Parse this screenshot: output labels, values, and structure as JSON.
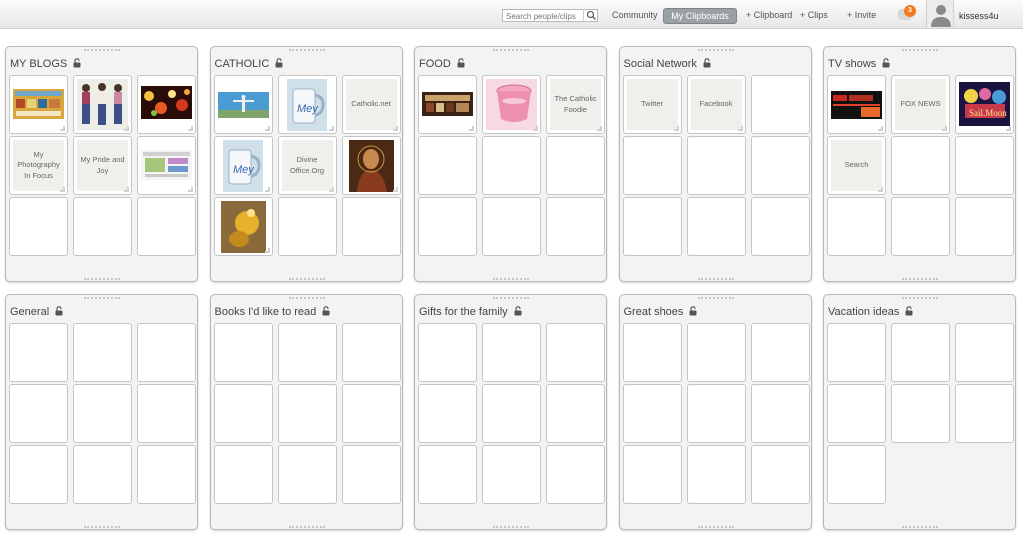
{
  "topbar": {
    "search_placeholder": "Search people/clips",
    "nav": {
      "community": "Community",
      "my_clipboards": "My Clipboards",
      "add_clipboard": "+ Clipboard",
      "add_clips": "+ Clips",
      "invite": "+ Invite"
    },
    "notification_count": "3",
    "username": "kissess4u"
  },
  "boards": [
    {
      "title": "MY BLOGS",
      "cells": [
        {
          "type": "image",
          "icon": "blog-banner"
        },
        {
          "type": "image",
          "icon": "girls-photo"
        },
        {
          "type": "image",
          "icon": "bokeh-lights"
        },
        {
          "type": "text",
          "text": "My Photography In Focus"
        },
        {
          "type": "text",
          "text": "My Pride and Joy"
        },
        {
          "type": "image",
          "icon": "blog-screenshot"
        },
        {
          "type": "empty"
        },
        {
          "type": "empty"
        },
        {
          "type": "empty"
        }
      ]
    },
    {
      "title": "CATHOLIC",
      "cells": [
        {
          "type": "image",
          "icon": "christ-statue"
        },
        {
          "type": "image",
          "icon": "mug"
        },
        {
          "type": "text",
          "text": "Catholic.net"
        },
        {
          "type": "image",
          "icon": "mug"
        },
        {
          "type": "text",
          "text": "Divine Office.Org"
        },
        {
          "type": "image",
          "icon": "jesus-painting"
        },
        {
          "type": "image",
          "icon": "golden-figure"
        },
        {
          "type": "empty"
        },
        {
          "type": "empty"
        }
      ]
    },
    {
      "title": "FOOD",
      "cells": [
        {
          "type": "image",
          "icon": "food-banner"
        },
        {
          "type": "image",
          "icon": "pink-drink"
        },
        {
          "type": "text",
          "text": "The Catholic Foodie"
        },
        {
          "type": "empty"
        },
        {
          "type": "empty"
        },
        {
          "type": "empty"
        },
        {
          "type": "empty"
        },
        {
          "type": "empty"
        },
        {
          "type": "empty"
        }
      ]
    },
    {
      "title": "Social Network",
      "cells": [
        {
          "type": "text",
          "text": "Twitter"
        },
        {
          "type": "text",
          "text": "Facebook"
        },
        {
          "type": "empty"
        },
        {
          "type": "empty"
        },
        {
          "type": "empty"
        },
        {
          "type": "empty"
        },
        {
          "type": "empty"
        },
        {
          "type": "empty"
        },
        {
          "type": "empty"
        }
      ]
    },
    {
      "title": "TV shows",
      "cells": [
        {
          "type": "image",
          "icon": "fox-news-banner"
        },
        {
          "type": "text",
          "text": "FOX NEWS"
        },
        {
          "type": "image",
          "icon": "sailor-moon"
        },
        {
          "type": "text",
          "text": "Search"
        },
        {
          "type": "empty"
        },
        {
          "type": "empty"
        },
        {
          "type": "empty"
        },
        {
          "type": "empty"
        },
        {
          "type": "empty"
        }
      ]
    },
    {
      "title": "General",
      "cells": [
        {
          "type": "empty"
        },
        {
          "type": "empty"
        },
        {
          "type": "empty"
        },
        {
          "type": "empty"
        },
        {
          "type": "empty"
        },
        {
          "type": "empty"
        },
        {
          "type": "empty"
        },
        {
          "type": "empty"
        },
        {
          "type": "empty"
        }
      ]
    },
    {
      "title": "Books I'd like to read",
      "cells": [
        {
          "type": "empty"
        },
        {
          "type": "empty"
        },
        {
          "type": "empty"
        },
        {
          "type": "empty"
        },
        {
          "type": "empty"
        },
        {
          "type": "empty"
        },
        {
          "type": "empty"
        },
        {
          "type": "empty"
        },
        {
          "type": "empty"
        }
      ]
    },
    {
      "title": "Gifts for the family",
      "cells": [
        {
          "type": "empty"
        },
        {
          "type": "empty"
        },
        {
          "type": "empty"
        },
        {
          "type": "empty"
        },
        {
          "type": "empty"
        },
        {
          "type": "empty"
        },
        {
          "type": "empty"
        },
        {
          "type": "empty"
        },
        {
          "type": "empty"
        }
      ]
    },
    {
      "title": "Great shoes",
      "cells": [
        {
          "type": "empty"
        },
        {
          "type": "empty"
        },
        {
          "type": "empty"
        },
        {
          "type": "empty"
        },
        {
          "type": "empty"
        },
        {
          "type": "empty"
        },
        {
          "type": "empty"
        },
        {
          "type": "empty"
        },
        {
          "type": "empty"
        }
      ]
    },
    {
      "title": "Vacation ideas",
      "cells": [
        {
          "type": "empty"
        },
        {
          "type": "empty"
        },
        {
          "type": "empty"
        },
        {
          "type": "empty"
        },
        {
          "type": "empty"
        },
        {
          "type": "empty"
        },
        {
          "type": "empty"
        }
      ]
    }
  ]
}
